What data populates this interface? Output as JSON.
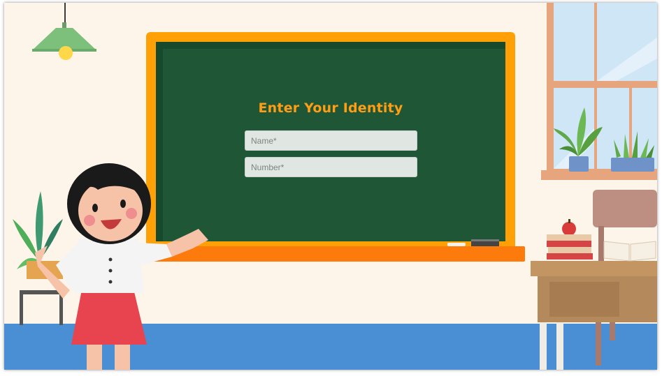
{
  "form": {
    "title": "Enter Your Identity",
    "name_placeholder": "Name*",
    "number_placeholder": "Number*"
  },
  "colors": {
    "wall": "#fdf5ea",
    "floor": "#4a8fd4",
    "board": "#1f5636",
    "board_frame": "#ffa007",
    "title": "#ff9d14"
  }
}
